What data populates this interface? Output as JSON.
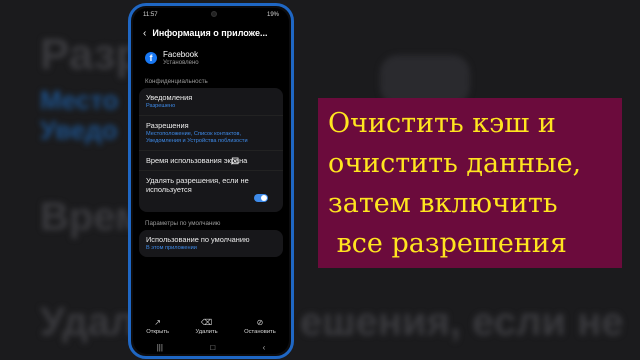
{
  "status": {
    "time": "11:57",
    "battery": "19%"
  },
  "appbar": {
    "back_icon": "arrow-left-icon",
    "title": "Информация о приложе..."
  },
  "app": {
    "name": "Facebook",
    "state": "Установлено"
  },
  "privacy_section": "Конфиденциальность",
  "items": [
    {
      "title": "Уведомления",
      "subtitle": "Разрешено"
    },
    {
      "title": "Разрешения",
      "subtitle": "Местоположение, Список контактов, Уведомления и Устройства поблизости"
    },
    {
      "title": "Время использования экрана",
      "subtitle": ""
    },
    {
      "title": "Удалять разрешения, если не используется",
      "subtitle": "",
      "toggle_on": true
    }
  ],
  "defaults_section": "Параметры по умолчанию",
  "default_item": {
    "title": "Использование по умолчанию",
    "subtitle": "В этом приложении"
  },
  "bottom_actions": [
    {
      "label": "Открыть",
      "icon": "open-external-icon"
    },
    {
      "label": "Удалить",
      "icon": "trash-icon"
    },
    {
      "label": "Остановить",
      "icon": "stop-icon"
    }
  ],
  "banner_lines": [
    "Очистить кэш и",
    "очистить данные,",
    "затем включить",
    " все разрешения"
  ],
  "colors": {
    "accent": "#3e8bea",
    "banner_bg": "#6b0b3c",
    "banner_text": "#ffe51f",
    "phone_frame": "#1f67c4"
  }
}
